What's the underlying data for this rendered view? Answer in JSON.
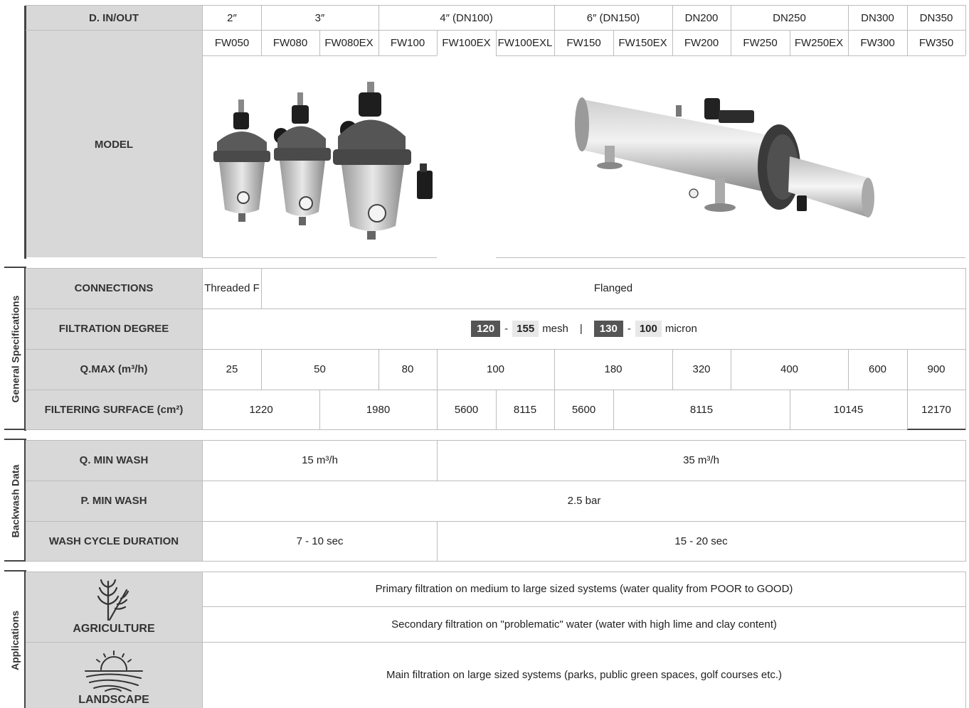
{
  "header": {
    "din_label": "D. IN/OUT",
    "sizes": [
      "2″",
      "3″",
      "4″ (DN100)",
      "6″ (DN150)",
      "DN200",
      "DN250",
      "DN300",
      "DN350"
    ],
    "models": [
      "FW050",
      "FW080",
      "FW080EX",
      "FW100",
      "FW100EX",
      "FW100EXL",
      "FW150",
      "FW150EX",
      "FW200",
      "FW250",
      "FW250EX",
      "FW300",
      "FW350"
    ],
    "model_label": "MODEL"
  },
  "general": {
    "section_label": "General Specifications",
    "connections_label": "CONNECTIONS",
    "connections": [
      "Threaded F",
      "Flanged"
    ],
    "filtration_label": "FILTRATION DEGREE",
    "filtration": {
      "mesh_a": "120",
      "mesh_b": "155",
      "mesh_unit": "mesh",
      "divider": "|",
      "micron_a": "130",
      "micron_b": "100",
      "micron_unit": "micron",
      "dash": "-"
    },
    "qmax_label": "Q.MAX (m³/h)",
    "qmax": [
      "25",
      "50",
      "80",
      "100",
      "180",
      "320",
      "400",
      "600",
      "900"
    ],
    "surface_label": "FILTERING SURFACE (cm²)",
    "surface": [
      "1220",
      "1980",
      "5600",
      "8115",
      "5600",
      "8115",
      "10145",
      "12170"
    ]
  },
  "backwash": {
    "section_label": "Backwash Data",
    "qmin_label": "Q. MIN WASH",
    "qmin": [
      "15 m³/h",
      "35 m³/h"
    ],
    "pmin_label": "P. MIN WASH",
    "pmin": "2.5 bar",
    "cycle_label": "WASH CYCLE DURATION",
    "cycle": [
      "7 - 10 sec",
      "15 - 20 sec"
    ]
  },
  "applications": {
    "section_label": "Applications",
    "agriculture_label": "AGRICULTURE",
    "landscape_label": "LANDSCAPE",
    "rows": [
      "Primary filtration on medium to large sized systems (water quality from POOR to GOOD)",
      "Secondary filtration on \"problematic\" water (water with high lime and clay content)",
      "Main filtration on large sized systems (parks, public green spaces, golf courses etc.)"
    ]
  }
}
